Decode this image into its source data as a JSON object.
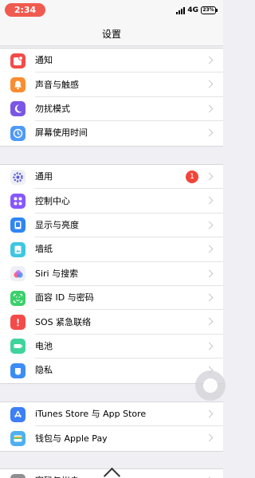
{
  "status": {
    "time": "2:34",
    "network": "4G",
    "battery": "23%"
  },
  "nav": {
    "title": "设置"
  },
  "groups": [
    {
      "items": [
        {
          "label": "通知",
          "icon": "notifications-icon",
          "color": "#f44a4a"
        },
        {
          "label": "声音与触感",
          "icon": "sound-icon",
          "color": "#fb8c2f"
        },
        {
          "label": "勿扰模式",
          "icon": "moon-icon",
          "color": "#7a56e6"
        },
        {
          "label": "屏幕使用时间",
          "icon": "hourglass-icon",
          "color": "#4f9af7"
        }
      ]
    },
    {
      "items": [
        {
          "label": "通用",
          "icon": "gear-icon",
          "color": "#eef0f5",
          "badge": "1"
        },
        {
          "label": "控制中心",
          "icon": "control-center-icon",
          "color": "#8757ff"
        },
        {
          "label": "显示与亮度",
          "icon": "display-icon",
          "color": "#2f86f3"
        },
        {
          "label": "墙纸",
          "icon": "wallpaper-icon",
          "color": "#3fc6e2"
        },
        {
          "label": "Siri 与搜索",
          "icon": "siri-icon",
          "color": "#eef0f5"
        },
        {
          "label": "面容 ID 与密码",
          "icon": "face-id-icon",
          "color": "#3bd06b"
        },
        {
          "label": "SOS 紧急联络",
          "icon": "sos-icon",
          "color": "#f44a4a"
        },
        {
          "label": "电池",
          "icon": "battery-icon",
          "color": "#3fd49c"
        },
        {
          "label": "隐私",
          "icon": "hand-icon",
          "color": "#3d8df5"
        }
      ]
    },
    {
      "items": [
        {
          "label": "iTunes Store 与 App Store",
          "icon": "app-store-icon",
          "color": "#3d7ff4"
        },
        {
          "label": "钱包与 Apple Pay",
          "icon": "wallet-icon",
          "color": "#4fb0f0"
        }
      ]
    },
    {
      "items": [
        {
          "label": "密码与帐户",
          "icon": "key-icon",
          "color": "#8e8e93"
        }
      ]
    }
  ]
}
